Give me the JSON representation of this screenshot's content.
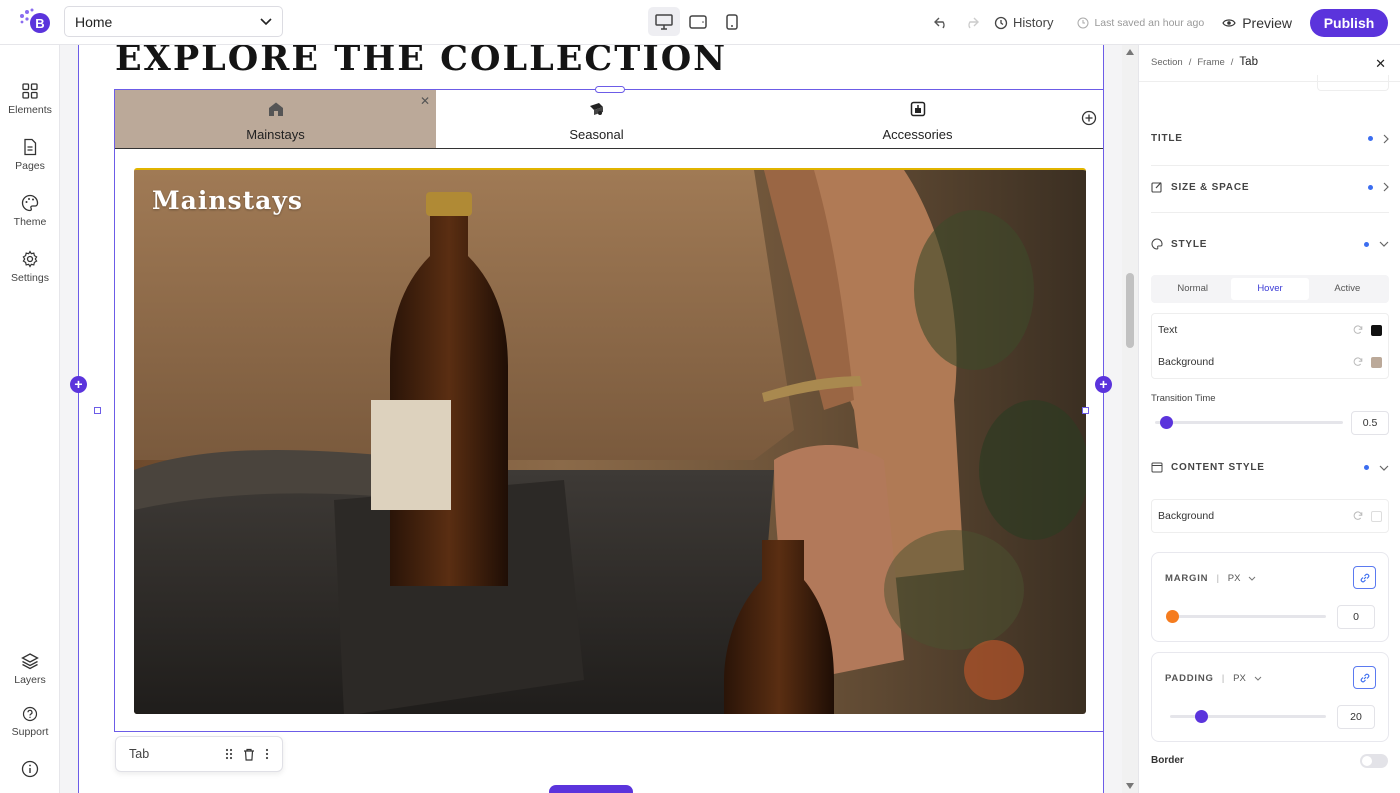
{
  "topbar": {
    "page_select": "Home",
    "history": "History",
    "last_saved": "Last saved an hour ago",
    "preview": "Preview",
    "publish": "Publish"
  },
  "rail": {
    "elements": "Elements",
    "pages": "Pages",
    "theme": "Theme",
    "settings": "Settings",
    "layers": "Layers",
    "support": "Support"
  },
  "canvas": {
    "heading": "EXPLORE THE COLLECTION",
    "tabs": [
      {
        "label": "Mainstays",
        "icon": "home-icon",
        "active": true
      },
      {
        "label": "Seasonal",
        "icon": "seasonal-icon",
        "active": false
      },
      {
        "label": "Accessories",
        "icon": "accessories-icon",
        "active": false
      }
    ],
    "content_title": "Mainstays",
    "tab_toolbar_label": "Tab",
    "colors": {
      "accent": "#5b34dc",
      "active_tab": "#bba999",
      "outline": "#6c5ce7"
    }
  },
  "panel": {
    "breadcrumb": [
      "Section",
      "Frame",
      "Tab"
    ],
    "sections": {
      "title": "TITLE",
      "size_space": "SIZE & SPACE",
      "style": "STYLE",
      "content_style": "CONTENT STYLE"
    },
    "state_tabs": [
      "Normal",
      "Hover",
      "Active"
    ],
    "active_state": "Hover",
    "text_label": "Text",
    "text_color": "#111111",
    "background_label": "Background",
    "background_color": "#bba999",
    "transition_label": "Transition Time",
    "transition_value": "0.5",
    "content_background_label": "Background",
    "margin": {
      "label": "MARGIN",
      "unit": "PX",
      "value": "0"
    },
    "padding": {
      "label": "PADDING",
      "unit": "PX",
      "value": "20"
    },
    "border_label": "Border"
  }
}
